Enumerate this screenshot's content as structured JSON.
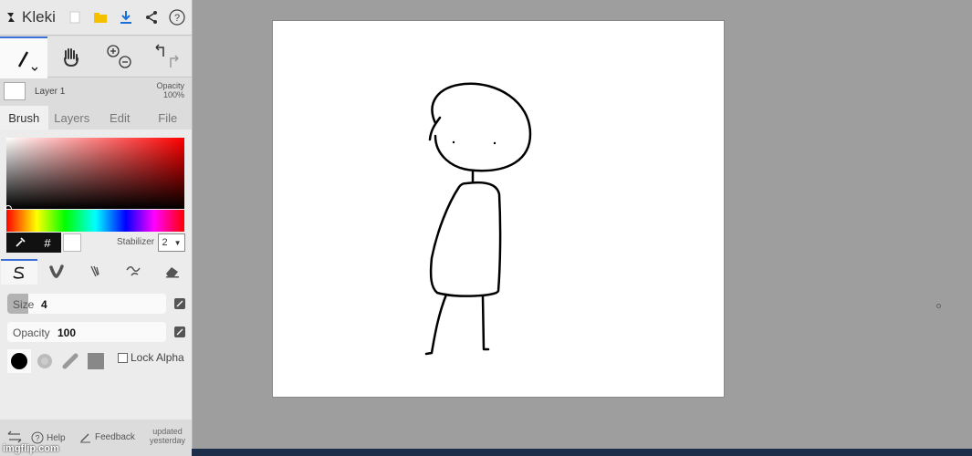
{
  "app": {
    "name": "Kleki"
  },
  "layer": {
    "name": "Layer 1",
    "opacity_label": "Opacity",
    "opacity_value": "100%"
  },
  "tabs": [
    {
      "label": "Brush",
      "active": true
    },
    {
      "label": "Layers",
      "active": false
    },
    {
      "label": "Edit",
      "active": false
    },
    {
      "label": "File",
      "active": false
    }
  ],
  "color": {
    "hex_button": "#",
    "current": "#ffffff",
    "primary_hue": "#ff0000"
  },
  "stabilizer": {
    "label": "Stabilizer",
    "value": "2"
  },
  "brush": {
    "size_label": "Size",
    "size_value": "4",
    "size_fraction": 0.13,
    "opacity_label": "Opacity",
    "opacity_value": "100",
    "opacity_fraction": 1.0,
    "lock_alpha_label": "Lock Alpha"
  },
  "bottom": {
    "help_label": "Help",
    "feedback_label": "Feedback",
    "updated_line1": "updated",
    "updated_line2": "yesterday"
  },
  "watermark": "imgflip.com",
  "colors": {
    "sidebar": "#dcdcdc",
    "workspace": "#9e9e9e",
    "accent": "#3a6fd8",
    "canvas": "#ffffff"
  }
}
